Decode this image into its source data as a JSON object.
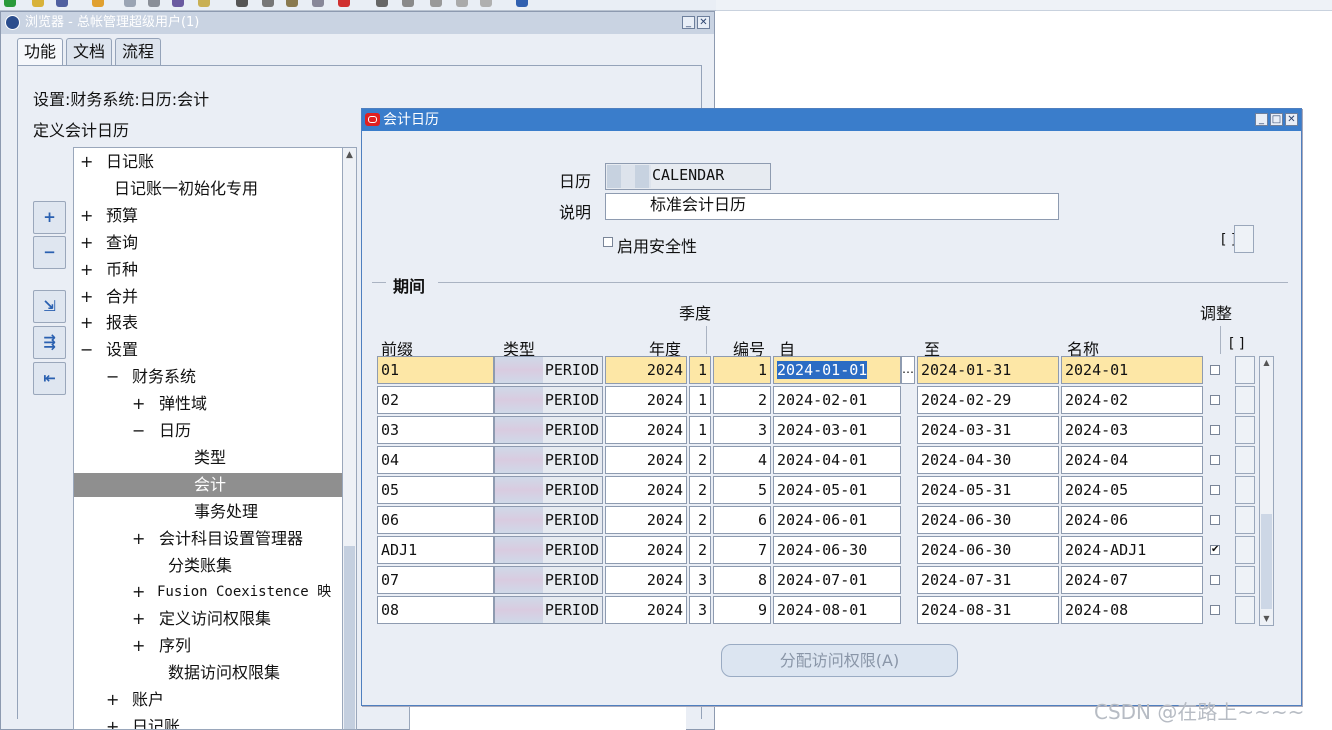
{
  "navigator": {
    "title": "浏览器 - 总帐管理超级用户(1)",
    "tabs": [
      "功能",
      "文档",
      "流程"
    ],
    "path": "设置:财务系统:日历:会计",
    "heading": "定义会计日历",
    "side_buttons": [
      "+",
      "−",
      "⇲",
      "⇶",
      "⇤"
    ],
    "tree": [
      {
        "prefix": "+",
        "label": "日记账"
      },
      {
        "prefix": "",
        "label": "日记账一初始化专用"
      },
      {
        "prefix": "+",
        "label": "预算"
      },
      {
        "prefix": "+",
        "label": "查询"
      },
      {
        "prefix": "+",
        "label": "币种"
      },
      {
        "prefix": "+",
        "label": "合并"
      },
      {
        "prefix": "+",
        "label": "报表"
      },
      {
        "prefix": "−",
        "label": "设置"
      },
      {
        "prefix": "−",
        "label": "财务系统"
      },
      {
        "prefix": "+",
        "label": "弹性域"
      },
      {
        "prefix": "−",
        "label": "日历"
      },
      {
        "prefix": "",
        "label": "类型"
      },
      {
        "prefix": "",
        "label": "会计"
      },
      {
        "prefix": "",
        "label": "事务处理"
      },
      {
        "prefix": "+",
        "label": "会计科目设置管理器"
      },
      {
        "prefix": "",
        "label": "分类账集"
      },
      {
        "prefix": "+",
        "label": "Fusion Coexistence 映"
      },
      {
        "prefix": "+",
        "label": "定义访问权限集"
      },
      {
        "prefix": "+",
        "label": "序列"
      },
      {
        "prefix": "",
        "label": "数据访问权限集"
      },
      {
        "prefix": "+",
        "label": "账户"
      },
      {
        "prefix": "+",
        "label": "日记账"
      }
    ]
  },
  "dialog": {
    "title": "会计日历",
    "calendar_label": "日历",
    "calendar_value": "CALENDAR",
    "desc_label": "说明",
    "desc_value": "标准会计日历",
    "security_label": "启用安全性",
    "dff_label": "[ ]",
    "period_section": "期间",
    "headers": {
      "quarter_group": "季度",
      "adjust_group": "调整",
      "prefix": "前缀",
      "type": "类型",
      "year": "年度",
      "number": "编号",
      "from": "自",
      "to": "至",
      "name": "名称",
      "dff": "[ ]"
    },
    "rows": [
      {
        "prefix": "01",
        "type": "PERIOD",
        "year": "2024",
        "quarter": "1",
        "num": "1",
        "from": "2024-01-01",
        "to": "2024-01-31",
        "name": "2024-01",
        "adjust": false
      },
      {
        "prefix": "02",
        "type": "PERIOD",
        "year": "2024",
        "quarter": "1",
        "num": "2",
        "from": "2024-02-01",
        "to": "2024-02-29",
        "name": "2024-02",
        "adjust": false
      },
      {
        "prefix": "03",
        "type": "PERIOD",
        "year": "2024",
        "quarter": "1",
        "num": "3",
        "from": "2024-03-01",
        "to": "2024-03-31",
        "name": "2024-03",
        "adjust": false
      },
      {
        "prefix": "04",
        "type": "PERIOD",
        "year": "2024",
        "quarter": "2",
        "num": "4",
        "from": "2024-04-01",
        "to": "2024-04-30",
        "name": "2024-04",
        "adjust": false
      },
      {
        "prefix": "05",
        "type": "PERIOD",
        "year": "2024",
        "quarter": "2",
        "num": "5",
        "from": "2024-05-01",
        "to": "2024-05-31",
        "name": "2024-05",
        "adjust": false
      },
      {
        "prefix": "06",
        "type": "PERIOD",
        "year": "2024",
        "quarter": "2",
        "num": "6",
        "from": "2024-06-01",
        "to": "2024-06-30",
        "name": "2024-06",
        "adjust": false
      },
      {
        "prefix": "ADJ1",
        "type": "PERIOD",
        "year": "2024",
        "quarter": "2",
        "num": "7",
        "from": "2024-06-30",
        "to": "2024-06-30",
        "name": "2024-ADJ1",
        "adjust": true
      },
      {
        "prefix": "07",
        "type": "PERIOD",
        "year": "2024",
        "quarter": "3",
        "num": "8",
        "from": "2024-07-01",
        "to": "2024-07-31",
        "name": "2024-07",
        "adjust": false
      },
      {
        "prefix": "08",
        "type": "PERIOD",
        "year": "2024",
        "quarter": "3",
        "num": "9",
        "from": "2024-08-01",
        "to": "2024-08-31",
        "name": "2024-08",
        "adjust": false
      }
    ],
    "lov_button": "…",
    "assign_button": "分配访问权限(A)"
  },
  "watermark": "CSDN @在路上~~~~"
}
